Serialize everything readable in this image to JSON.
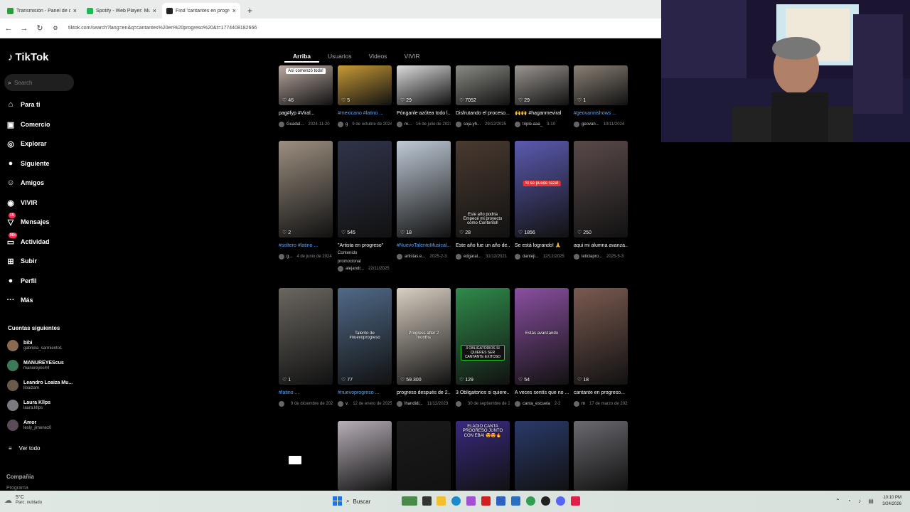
{
  "browser": {
    "tabs": [
      {
        "title": "Transmisión - Panel de control",
        "color": "#2c9c3c",
        "active": false
      },
      {
        "title": "Spotify - Web Player: Music for",
        "color": "#1db954",
        "active": false
      },
      {
        "title": "Find 'cantantes en progreso' on",
        "color": "#222222",
        "active": true
      }
    ],
    "new_tab": "+",
    "url": "tiktok.com/search?lang=en&q=cantantes%20en%20progreso%20&t=1774408182666"
  },
  "sidebar": {
    "logo": "TikTok",
    "search_placeholder": "Search",
    "nav": [
      {
        "label": "Para ti",
        "icon": "home-icon",
        "glyph": "⌂"
      },
      {
        "label": "Comercio",
        "icon": "shop-icon",
        "glyph": "▣"
      },
      {
        "label": "Explorar",
        "icon": "compass-icon",
        "glyph": "◎"
      },
      {
        "label": "Siguiente",
        "icon": "following-icon",
        "glyph": "●"
      },
      {
        "label": "Amigos",
        "icon": "friends-icon",
        "glyph": "☺"
      },
      {
        "label": "VIVIR",
        "icon": "live-icon",
        "glyph": "◉"
      },
      {
        "label": "Mensajes",
        "icon": "messages-icon",
        "glyph": "▽",
        "badge": "15"
      },
      {
        "label": "Actividad",
        "icon": "activity-icon",
        "glyph": "▭",
        "badge": "99+"
      },
      {
        "label": "Subir",
        "icon": "upload-icon",
        "glyph": "⊞"
      },
      {
        "label": "Perfil",
        "icon": "profile-icon",
        "glyph": "●"
      },
      {
        "label": "Más",
        "icon": "more-icon",
        "glyph": "···"
      }
    ],
    "following_title": "Cuentas siguientes",
    "following": [
      {
        "name": "bibi",
        "handle": "gabriela_sarmiento1"
      },
      {
        "name": "MANUREYEScus",
        "handle": "manureyes44"
      },
      {
        "name": "Leandro Loaiza Mu...",
        "handle": "lloaizam"
      },
      {
        "name": "Laura Kllps",
        "handle": "laura.kllps"
      },
      {
        "name": "Amor",
        "handle": "lesly_jimenez0"
      }
    ],
    "see_all": "Ver todo",
    "company": "Compañía",
    "program": "Programa"
  },
  "tabs": [
    "Arriba",
    "Usuarios",
    "Videos",
    "VIVIR"
  ],
  "videos": [
    {
      "likes": "46",
      "overlay": "Así comenzó todo!",
      "caption": "pag#fyp #Viral...",
      "hashtag": false,
      "author": "Guadal...",
      "date": "2024-11-20",
      "color": "#b9a8a0"
    },
    {
      "likes": "5",
      "caption": "#mexicano #latino ...",
      "hashtag": true,
      "author": "g",
      "date": "9 de octubre de 2024",
      "color": "#c89a35"
    },
    {
      "likes": "29",
      "caption": "Pónganle azótea todo l...",
      "hashtag": false,
      "author": "m...",
      "date": "16 de julio de 2021",
      "color": "#dcdcdc"
    },
    {
      "likes": "7052",
      "caption": "Disfrutando el proceso...",
      "hashtag": false,
      "author": "soja.yh...",
      "date": "29/12/2025",
      "color": "#8a8a84"
    },
    {
      "likes": "29",
      "caption": "🙌🙌 #haganmeviral",
      "hashtag": false,
      "author": "triple.aaa_",
      "date": "3-10",
      "color": "#9a9590"
    },
    {
      "likes": "1",
      "caption": "#geovannishows ...",
      "hashtag": true,
      "author": "geovan...",
      "date": "10/11/2024",
      "color": "#8a8175"
    },
    {
      "likes": "2",
      "caption": "#soltero #latino ...",
      "hashtag": true,
      "author": "g...",
      "date": "4 de junio de 2024",
      "color": "#9c8f80"
    },
    {
      "likes": "545",
      "caption": "\"Artista en progreso\"",
      "hashtag": false,
      "sub1": "Contenido",
      "sub2": "promocional",
      "author": "alejandr...",
      "date": "22/11/2025",
      "color": "#30344a"
    },
    {
      "likes": "18",
      "caption": "#NuevoTalentoMusical...",
      "hashtag": true,
      "author": "artistas.e...",
      "date": "2025-2-3",
      "color": "#bfcad6"
    },
    {
      "likes": "28",
      "overlay": "Este año podria Empecé mi proyecto como Contentol!",
      "overlayStyle": "plain",
      "caption": "Este año fue un año de...",
      "hashtag": false,
      "author": "edgaral...",
      "date": "31/12/2021",
      "color": "#4a3a30"
    },
    {
      "likes": "1856",
      "overlay": "Si se puede raza!",
      "overlayStyle": "red",
      "caption": "Se está logrando! 🙏",
      "hashtag": false,
      "author": "danteji...",
      "date": "12/12/2025",
      "color": "#5b5ab0"
    },
    {
      "likes": "250",
      "caption": "aqui mi alumna avanza...",
      "hashtag": false,
      "author": "leticiapro...",
      "date": "2025-5-3",
      "color": "#5a4a4a"
    },
    {
      "likes": "1",
      "caption": "#latino ...",
      "hashtag": true,
      "author": "",
      "date": "9 de diciembre de 2024",
      "color": "#6a6660"
    },
    {
      "likes": "77",
      "overlay": "Talento de #nuevoprogreso",
      "overlayStyle": "plain",
      "caption": "#nuevoprogreso ...",
      "hashtag": true,
      "author": "v.",
      "date": "12 de enero de 2025",
      "color": "#506a88"
    },
    {
      "likes": "59.300",
      "overlay": "Progress after 2 months",
      "overlayStyle": "plain",
      "caption": "progreso después de 2...",
      "hashtag": false,
      "author": "lhandidi...",
      "date": "11/12/2023",
      "color": "#d9cfc2"
    },
    {
      "likes": "129",
      "overlay": "3 OBLIGATORIOS SI QUIERES SER CANTANTE EXITOSO",
      "overlayStyle": "dark",
      "caption": "3 Obligatorios si quiere...",
      "hashtag": false,
      "author": "",
      "date": "30 de septiembre de 2024",
      "color": "#2f8a4a"
    },
    {
      "likes": "54",
      "overlay": "Estás avanzando",
      "overlayStyle": "plain",
      "caption": "A veces sentís que no ...",
      "hashtag": false,
      "author": "canta_escuela",
      "date": "2-2",
      "color": "#8a4fa0"
    },
    {
      "likes": "18",
      "caption": "cantante en progreso...",
      "hashtag": false,
      "author": "m",
      "date": "17 de marzo de 2022",
      "color": "#7a5a50"
    },
    {
      "likes": "",
      "caption": "",
      "author": "",
      "date": "",
      "color": "#b8b0b8"
    },
    {
      "likes": "",
      "caption": "",
      "author": "",
      "date": "",
      "color": "#1a1a1a"
    },
    {
      "likes": "",
      "overlay": "ELADIO CANTA PROGRESO JUNTO CON EBAI 😍😍🔥",
      "overlayStyle": "plain",
      "caption": "",
      "author": "",
      "date": "",
      "color": "#3a2a80"
    },
    {
      "likes": "",
      "caption": "",
      "author": "",
      "date": "",
      "color": "#2a3a6a"
    },
    {
      "likes": "",
      "caption": "",
      "author": "",
      "date": "",
      "color": "#6a6a70"
    }
  ],
  "taskbar": {
    "temp": "5°C",
    "condition": "Parc. nublado",
    "search": "Buscar",
    "time": "10:10 PM",
    "date": "3/24/2026"
  }
}
